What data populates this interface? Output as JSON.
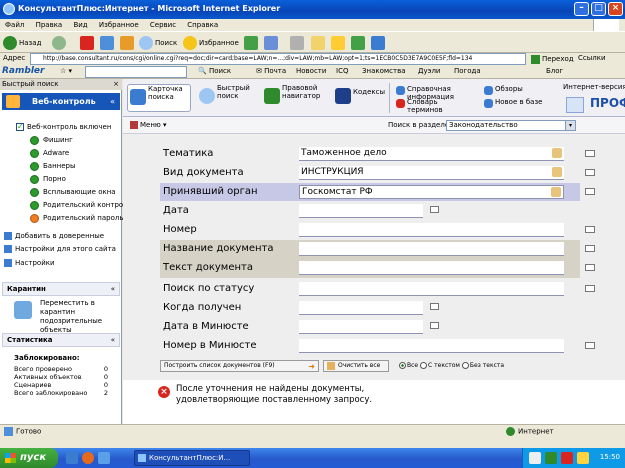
{
  "window": {
    "title": "КонсультантПлюс:Интернет - Microsoft Internet Explorer",
    "controls": [
      "minimize",
      "maximize",
      "close"
    ]
  },
  "menubar": [
    "Файл",
    "Правка",
    "Вид",
    "Избранное",
    "Сервис",
    "Справка"
  ],
  "toolbar": {
    "back": "Назад",
    "search": "Поиск",
    "favorites": "Избранное"
  },
  "address": {
    "label": "Адрес",
    "url": "http://base.consultant.ru/cons/cgi/online.cgi?req=doc;dir=card;base=LAW;n=...;div=LAW;mb=LAW;opt=1;ts=1ECB0C5D3E7A9C0E5F;fld=134",
    "go": "Переход",
    "links": "Ссылки"
  },
  "rambler": {
    "logo": "Rambler",
    "items": [
      "Поиск",
      "Почта",
      "Новости",
      "Знакомства",
      "Дуэли",
      "Погода",
      "Блог"
    ]
  },
  "left_panel": {
    "header": "Быстрый поиск",
    "main_section": "Веб-контроль",
    "main_checkbox": "Веб-контроль включен",
    "items": [
      {
        "label": "Фишинг",
        "color": "#2e9a2e"
      },
      {
        "label": "Adware",
        "color": "#2e9a2e"
      },
      {
        "label": "Баннеры",
        "color": "#2e9a2e"
      },
      {
        "label": "Порно",
        "color": "#2e9a2e"
      },
      {
        "label": "Всплывающие окна",
        "color": "#2e9a2e"
      },
      {
        "label": "Родительский контроль",
        "color": "#2e9a2e"
      },
      {
        "label": "Родительский пароль",
        "color": "#f07d20"
      }
    ],
    "links": [
      "Добавить в доверенные",
      "Настройки для этого сайта",
      "Настройки"
    ],
    "sec2": {
      "title": "Карантин",
      "text": "Переместить в карантин подозрительные объекты"
    },
    "sec3": {
      "title": "Статистика",
      "subtitle": "Заблокировано:",
      "rows": [
        {
          "label": "Всего проверено",
          "value": "0"
        },
        {
          "label": "Активных объектов",
          "value": "0"
        },
        {
          "label": "Сценариев",
          "value": "0"
        },
        {
          "label": "Всего заблокировано",
          "value": "2"
        }
      ]
    }
  },
  "tabs": [
    {
      "label": "Карточка поиска",
      "active": true
    },
    {
      "label": "Быстрый поиск",
      "active": false
    },
    {
      "label": "Правовой навигатор",
      "active": false
    },
    {
      "label": "Кодексы",
      "active": false
    },
    {
      "label": "Справочная информация",
      "active": false
    },
    {
      "label": "Словарь терминов",
      "active": false
    },
    {
      "label": "Обзоры",
      "active": false
    },
    {
      "label": "Новое в базе",
      "active": false
    },
    {
      "label": "Интернет-версия",
      "active": false
    }
  ],
  "prof_logo": "ПРОФ",
  "subheader": {
    "left": "Меню",
    "region_label": "Поиск в разделе",
    "region_value": "Законодательство"
  },
  "form_fields": [
    {
      "label": "Тематика",
      "value": "Таможенное дело",
      "style": "normal",
      "kind": "select"
    },
    {
      "label": "Вид документа",
      "value": "ИНСТРУКЦИЯ",
      "style": "normal",
      "kind": "select"
    },
    {
      "label": "Принявший орган",
      "value": "Госкомстат РФ",
      "style": "highlight",
      "kind": "select"
    },
    {
      "label": "Дата",
      "value": "",
      "style": "normal",
      "kind": "short"
    },
    {
      "label": "Номер",
      "value": "",
      "style": "normal",
      "kind": "text"
    },
    {
      "label": "Название документа",
      "value": "",
      "style": "gray",
      "kind": "text"
    },
    {
      "label": "Текст документа",
      "value": "",
      "style": "gray",
      "kind": "text"
    },
    {
      "label": "Поиск по статусу",
      "value": "",
      "style": "normal",
      "kind": "text"
    },
    {
      "label": "Когда получен",
      "value": "",
      "style": "normal",
      "kind": "short"
    },
    {
      "label": "Дата в Минюсте",
      "value": "",
      "style": "normal",
      "kind": "short"
    },
    {
      "label": "Номер в Минюсте",
      "value": "",
      "style": "normal",
      "kind": "text"
    }
  ],
  "actions": {
    "build": "Построить список документов (F9)",
    "clear": "Очистить все",
    "radios": [
      {
        "label": "Все",
        "on": true
      },
      {
        "label": "С текстом",
        "on": false
      },
      {
        "label": "Без текста",
        "on": false
      }
    ]
  },
  "message": {
    "line1": "После уточнения не найдены документы,",
    "line2": "удовлетворяющие поставленному запросу."
  },
  "status": {
    "left": "Готово",
    "zone": "Интернет"
  },
  "taskbar": {
    "start": "пуск",
    "button": "КонсультантПлюс:И...",
    "time": "15:50"
  }
}
